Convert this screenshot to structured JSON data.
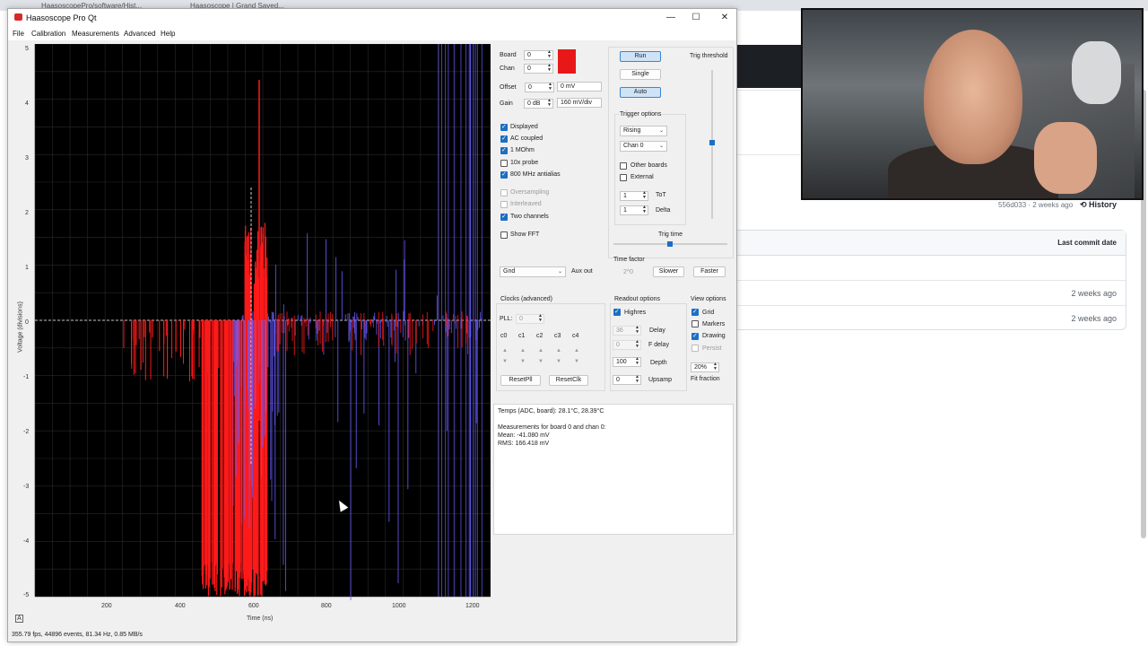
{
  "browser": {
    "tab1": "HaasoscopePro/software/Hist...",
    "tab2": "Haasoscope | Grand Saved...",
    "commit_text": "556d033 · 2 weeks ago",
    "history_label": "History",
    "table_header_last_commit": "Last commit date",
    "rows": [
      "2 weeks ago",
      "2 weeks ago"
    ]
  },
  "window": {
    "title": "Haasoscope Pro Qt",
    "minimize": "—",
    "maximize": "☐",
    "close": "✕"
  },
  "menu": [
    "File",
    "Calibration",
    "Measurements",
    "Advanced",
    "Help"
  ],
  "plot": {
    "y_ticks": [
      "5",
      "4",
      "3",
      "2",
      "1",
      "0",
      "-1",
      "-2",
      "-3",
      "-4",
      "-5"
    ],
    "x_ticks": [
      "200",
      "400",
      "600",
      "800",
      "1000",
      "1200"
    ],
    "ylabel": "Voltage (divisions)",
    "xlabel": "Time (ns)",
    "corner": "A",
    "colors": {
      "ch0": "#ff1a1a",
      "ch1": "#6a5cff",
      "bg": "#000000",
      "grid": "#2a2a2a"
    }
  },
  "status": "355.79 fps, 44896 events, 81.34 Hz, 0.85 MB/s",
  "channel": {
    "board_label": "Board",
    "board_value": "0",
    "chan_label": "Chan",
    "chan_value": "0",
    "offset_label": "Offset",
    "offset_value": "0",
    "offset_unit": "0 mV",
    "gain_label": "Gain",
    "gain_value": "0 dB",
    "gain_unit": "160 mV/div",
    "swatch_color": "#e81818",
    "checks": [
      {
        "label": "Displayed",
        "on": true,
        "dim": false
      },
      {
        "label": "AC coupled",
        "on": true,
        "dim": false
      },
      {
        "label": "1 MOhm",
        "on": true,
        "dim": false
      },
      {
        "label": "10x probe",
        "on": false,
        "dim": false
      },
      {
        "label": "800 MHz antialias",
        "on": true,
        "dim": false
      },
      {
        "label": "Oversampling",
        "on": false,
        "dim": true
      },
      {
        "label": "Interleaved",
        "on": false,
        "dim": true
      },
      {
        "label": "Two channels",
        "on": true,
        "dim": false
      },
      {
        "label": "Show FFT",
        "on": false,
        "dim": false
      }
    ],
    "aux_select": "Gnd",
    "aux_label": "Aux out"
  },
  "trigger": {
    "run": "Run",
    "single": "Single",
    "auto": "Auto",
    "threshold_label": "Trig threshold",
    "options_label": "Trigger options",
    "edge": "Rising",
    "chan": "Chan 0",
    "other_boards": "Other boards",
    "external": "External",
    "tot_value": "1",
    "tot_label": "ToT",
    "delta_value": "1",
    "delta_label": "Delta",
    "trig_time_label": "Trig time",
    "time_factor_label": "Time factor",
    "time_factor_value": "2^0",
    "slower": "Slower",
    "faster": "Faster"
  },
  "clocks": {
    "title": "Clocks (advanced)",
    "pll_label": "PLL:",
    "pll_value": "0",
    "phases": [
      "c0",
      "c1",
      "c2",
      "c3",
      "c4"
    ],
    "reset_pll": "ResetPll",
    "reset_clk": "ResetClk"
  },
  "readout_opts": {
    "title": "Readout options",
    "highres": "Highres",
    "delay_value": "36",
    "delay_label": "Delay",
    "fdelay_value": "0",
    "fdelay_label": "F delay",
    "depth_value": "100",
    "depth_label": "Depth",
    "upsamp_value": "0",
    "upsamp_label": "Upsamp"
  },
  "view": {
    "title": "View options",
    "grid": "Grid",
    "markers": "Markers",
    "drawing": "Drawing",
    "persist": "Persist",
    "fit_value": "20%",
    "fit_label": "Fit fraction"
  },
  "readout": {
    "temps": "Temps (ADC, board): 28.1°C, 28.39°C",
    "meas_title": "Measurements for board 0 and chan 0:",
    "mean": "Mean: -41.080 mV",
    "rms": "RMS: 166.418 mV"
  }
}
